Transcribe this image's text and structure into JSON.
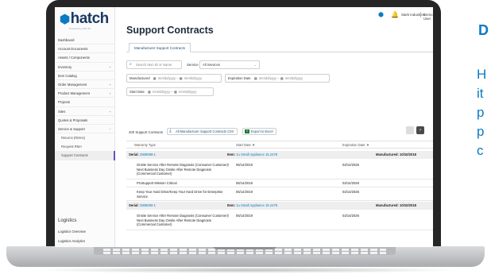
{
  "sidebar": {
    "logo": "hatch",
    "logo_sub": "Powered by ARC 50",
    "items": [
      {
        "label": "Dashboard",
        "chevron": ""
      },
      {
        "label": "Account Documents",
        "chevron": ""
      },
      {
        "label": "Assets / Components",
        "chevron": ""
      },
      {
        "label": "Inventory",
        "chevron": "+"
      },
      {
        "label": "Item Catalog",
        "chevron": ""
      },
      {
        "label": "Order Management",
        "chevron": "+"
      },
      {
        "label": "Product Management",
        "chevron": "+"
      },
      {
        "label": "Projects",
        "chevron": ""
      },
      {
        "label": "Sites",
        "chevron": "+"
      },
      {
        "label": "Quotes & Proposals",
        "chevron": ""
      },
      {
        "label": "Service & Support",
        "chevron": "−"
      }
    ],
    "sub_items": [
      "Returns (RMAs)",
      "Request RMA",
      "Support Contracts"
    ],
    "logistics_title": "Logistics",
    "logistics_items": [
      "Logistics Overview",
      "Logistics Analytics"
    ]
  },
  "topbar": {
    "org": "Stark Industries",
    "user": "Demo User"
  },
  "page": {
    "title": "Support Contracts",
    "tab": "Manufacturer Support Contracts"
  },
  "filters": {
    "search_placeholder": "Search Item ID or Name",
    "service_label": "Service",
    "service_value": "All Services",
    "manufactured_label": "Manufactured",
    "date_placeholder": "mm/dd/yyyy",
    "range_sep": "–",
    "expiration_label": "Expiration Date",
    "start_label": "Start Date"
  },
  "toolbar": {
    "count": "400 Support Contracts",
    "csv_button": "All Manufacturer Support Contracts CSV",
    "excel_button": "Export to Excel"
  },
  "table": {
    "headers": {
      "type": "Warranty Type",
      "start": "Start Date",
      "exp": "Expiration Date"
    },
    "sort_icon": "▼",
    "serial_label": "Serial:",
    "item_label": "Item:",
    "manufactured_label": "Manufactured:",
    "groups": [
      {
        "serial": "2808088-1",
        "item": "1u Small Appliance 15.2478",
        "manufactured": "10/10/2018",
        "rows": [
          {
            "type": "Onsite Service After Remote Diagnosis (Consumer Customer)/ Next Business Day Onsite After Remote Diagnosis (Commercial Customer)",
            "start": "06/14/2019",
            "exp": "03/14/2026"
          },
          {
            "type": "ProSupport Mission Critical",
            "start": "06/14/2019",
            "exp": "03/14/2026"
          },
          {
            "type": "Keep Your Hard Drive/Keep Your Hard Drive for Enterprise Service",
            "start": "06/14/2019",
            "exp": "03/14/2026"
          }
        ]
      },
      {
        "serial": "2808080-1",
        "item": "1u Small Appliance 15.2478",
        "manufactured": "10/10/2018",
        "rows": [
          {
            "type": "Onsite Service After Remote Diagnosis (Consumer Customer)/ Next Business Day Onsite After Remote Diagnosis (Commercial Customer)",
            "start": "06/14/2019",
            "exp": "03/14/2026"
          }
        ]
      }
    ]
  },
  "marketing": {
    "heading": "D",
    "lines": [
      "H",
      "it",
      "p",
      "p",
      "c"
    ]
  },
  "colors": {
    "accent": "#0a7bc4",
    "navy": "#1b3a63",
    "active_marker": "#6b4fbb",
    "excel_green": "#1f7a3c"
  }
}
